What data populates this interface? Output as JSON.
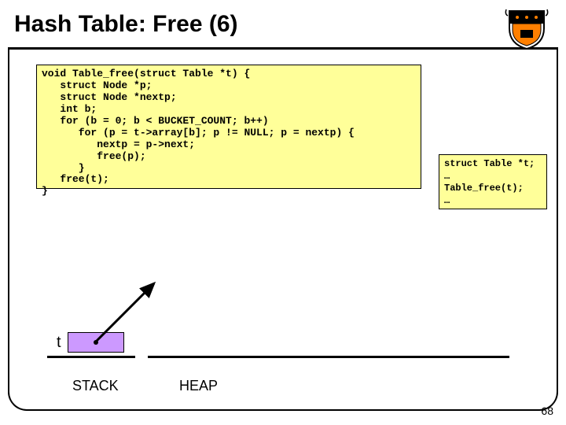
{
  "title": "Hash Table: Free (6)",
  "code": "void Table_free(struct Table *t) {\n   struct Node *p;\n   struct Node *nextp;\n   int b;\n   for (b = 0; b < BUCKET_COUNT; b++)\n      for (p = t->array[b]; p != NULL; p = nextp) {\n         nextp = p->next;\n         free(p);\n      }\n   free(t);\n}",
  "caller": "struct Table *t;\n…\nTable_free(t);\n…",
  "t_label": "t",
  "stack_label": "STACK",
  "heap_label": "HEAP",
  "page_number": "68"
}
